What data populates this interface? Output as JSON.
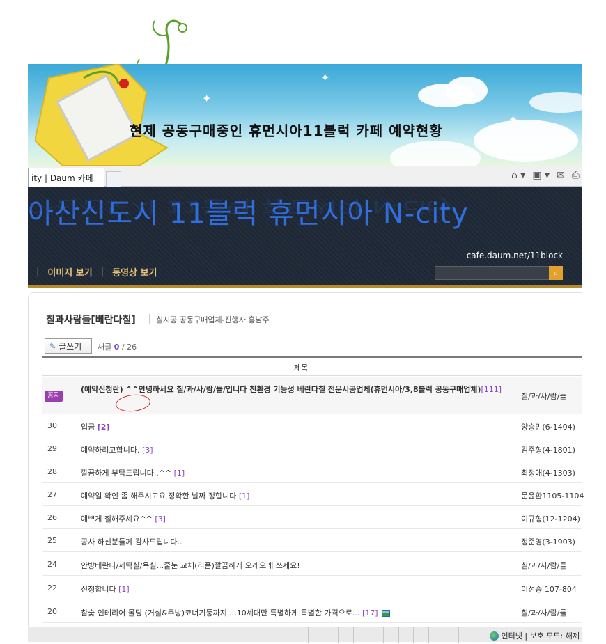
{
  "banner": {
    "title": "현제 공동구매중인 휴먼시아11블럭 카페 예약현황"
  },
  "browser": {
    "tab_label": "ity | Daum 카페",
    "toolbar_icons": [
      "home-icon",
      "feed-icon",
      "mail-icon",
      "print-icon"
    ]
  },
  "cafe": {
    "title": "아산신도시 11블럭 휴먼시아 N-city",
    "url": "cafe.daum.net/11block",
    "nav": [
      "이미지 보기",
      "동영상 보기"
    ],
    "search_icon": "search-icon"
  },
  "board": {
    "title": "칠과사람들[베란다칠]",
    "description": "칠시공 공동구매업체-진행자 홍남주",
    "write_label": "글쓰기",
    "new_label": "새글",
    "new_count": "0",
    "total_count": "/ 26",
    "column_title": "제목"
  },
  "notice": {
    "badge": "공지",
    "subject": "(예약신청란) ^^안녕하세요 칠/과/사/람/들/입니다 친환경 기능성 베란다칠 전문시공업체(휴먼시아/3,8블럭 공동구매업체)",
    "comments": "[111]",
    "author": "칠/과/사/람/들"
  },
  "posts": [
    {
      "num": "30",
      "subject": "입금",
      "comments": "[2]",
      "author": "양승민(6-1404)",
      "bold_comment": true
    },
    {
      "num": "29",
      "subject": "예약하려고합니다.",
      "comments": "[3]",
      "author": "김주형(4-1801)"
    },
    {
      "num": "28",
      "subject": "깔끔하게 부탁드립니다..^^",
      "comments": "[1]",
      "author": "최정애(4-1303)"
    },
    {
      "num": "27",
      "subject": "예약일 확인 좀 해주시고요 정확한 날짜 정합니다",
      "comments": "[1]",
      "author": "문윤환1105-1104"
    },
    {
      "num": "26",
      "subject": "예쁘게 칠해주세요^^",
      "comments": "[3]",
      "author": "이규형(12-1204)"
    },
    {
      "num": "25",
      "subject": "공사 하신분들께 감사드립니다..",
      "comments": "",
      "author": "정준영(3-1903)"
    },
    {
      "num": "24",
      "subject": "안방베란다/세탁실/욕실...줄눈 교체(리폼)깔끔하게 오래오래 쓰세요!",
      "comments": "",
      "author": "칠/과/사/람/들"
    },
    {
      "num": "22",
      "subject": "신청합니다",
      "comments": "[1]",
      "author": "이선승 107-804"
    },
    {
      "num": "20",
      "subject": "참숯 인테리어 몰딩 (거실&주방)코너기둥까지....10세대만 특별하게 특별한 가격으로...",
      "comments": "[17]",
      "author": "칠/과/사/람/들",
      "has_image": true
    }
  ],
  "status": {
    "text": "인터넷 | 보호 모드: 해제"
  }
}
